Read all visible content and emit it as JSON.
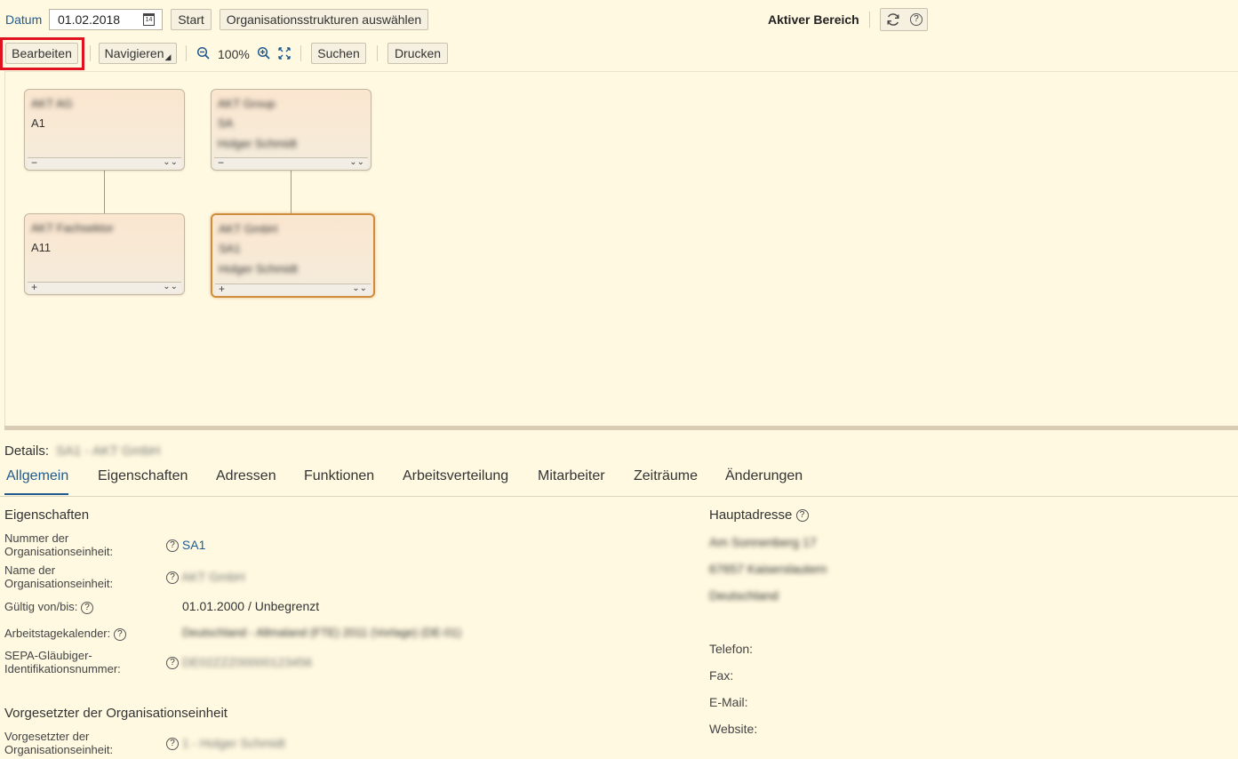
{
  "toolbar": {
    "datum_label": "Datum",
    "date_value": "01.02.2018",
    "calendar_day": "14",
    "start_label": "Start",
    "org_select_label": "Organisationsstrukturen auswählen",
    "active_area_label": "Aktiver Bereich",
    "help_glyph": "?",
    "edit_label": "Bearbeiten",
    "navigate_label": "Navigieren",
    "zoom_value": "100%",
    "search_label": "Suchen",
    "print_label": "Drucken"
  },
  "org_chart": {
    "nodes": [
      {
        "lines": [
          "AKT AG",
          "A1"
        ],
        "expand": "−",
        "collapse_glyph": "⌄⌄"
      },
      {
        "lines": [
          "AKT Group",
          "SA",
          "Holger Schmidt"
        ],
        "expand": "−",
        "collapse_glyph": "⌄⌄"
      },
      {
        "lines": [
          "AKT Fachsektor",
          "A11"
        ],
        "expand": "+",
        "collapse_glyph": "⌄⌄"
      },
      {
        "lines": [
          "AKT GmbH",
          "SA1",
          "Holger Schmidt"
        ],
        "expand": "+",
        "collapse_glyph": "⌄⌄"
      }
    ]
  },
  "details": {
    "label": "Details:",
    "selected_name": "SA1 - AKT GmbH",
    "tabs": [
      "Allgemein",
      "Eigenschaften",
      "Adressen",
      "Funktionen",
      "Arbeitsverteilung",
      "Mitarbeiter",
      "Zeiträume",
      "Änderungen"
    ],
    "properties": {
      "heading": "Eigenschaften",
      "number_label_1": "Nummer der",
      "number_label_2": "Organisationseinheit:",
      "number_value": "SA1",
      "name_label_1": "Name der",
      "name_label_2": "Organisationseinheit:",
      "name_value": "AKT GmbH",
      "valid_label": "Gültig von/bis:",
      "valid_value": "01.01.2000 / Unbegrenzt",
      "calendar_label": "Arbeitstagekalender:",
      "calendar_value": "Deutschland - Allmaland (FTE) 2011 (Vorlage) (DE-01)",
      "sepa_label_1": "SEPA-Gläubiger-",
      "sepa_label_2": "Identifikationsnummer:",
      "sepa_value": "DE02ZZZ00000123456"
    },
    "supervisor": {
      "heading": "Vorgesetzter der Organisationseinheit",
      "label_1": "Vorgesetzter der",
      "label_2": "Organisationseinheit:",
      "value": "1 - Holger Schmidt"
    },
    "address": {
      "heading": "Hauptadresse",
      "street": "Am Sonnenberg 17",
      "city": "67657 Kaiserslautern",
      "country": "Deutschland",
      "phone_label": "Telefon:",
      "fax_label": "Fax:",
      "email_label": "E-Mail:",
      "website_label": "Website:"
    }
  }
}
